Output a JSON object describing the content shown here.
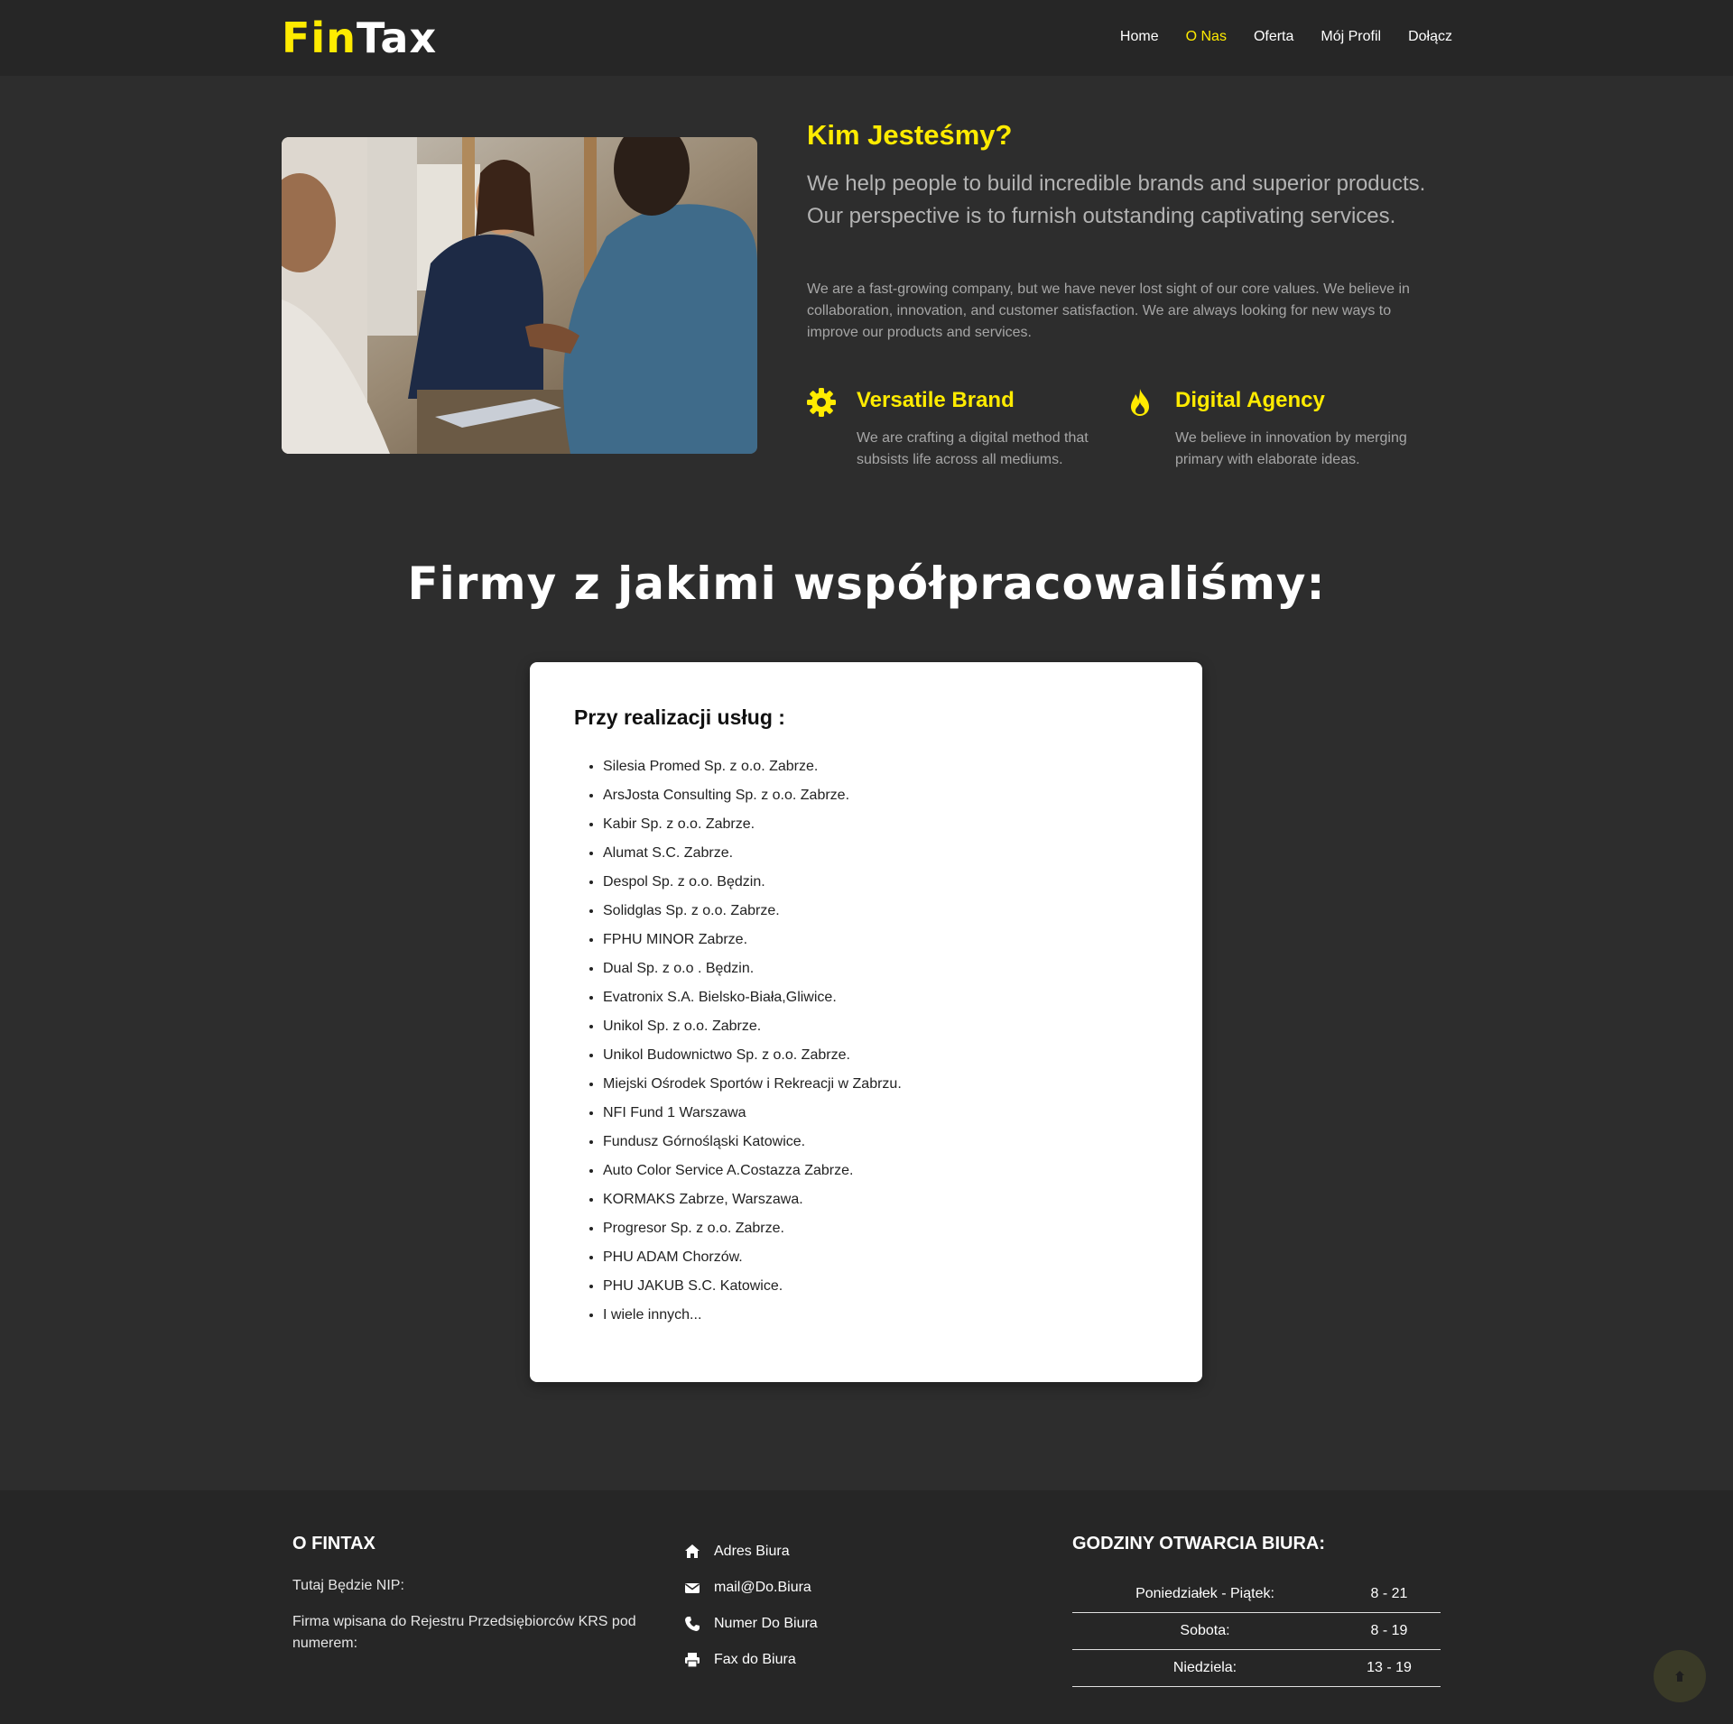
{
  "brand": {
    "part1": "Fin",
    "part2": "Tax",
    "accent": "#ffeb00"
  },
  "nav": {
    "items": [
      {
        "label": "Home"
      },
      {
        "label": "O Nas",
        "active": true
      },
      {
        "label": "Oferta"
      },
      {
        "label": "Mój Profil"
      },
      {
        "label": "Dołącz"
      }
    ]
  },
  "about": {
    "image": "business-handshake-photo",
    "title": "Kim Jesteśmy?",
    "lead": "We help people to build incredible brands and superior products. Our perspective is to furnish outstanding captivating services.",
    "text": "We are a fast-growing company, but we have never lost sight of our core values. We believe in collaboration, innovation, and customer satisfaction. We are always looking for new ways to improve our products and services.",
    "features": [
      {
        "icon": "gear-icon",
        "title": "Versatile Brand",
        "text": "We are crafting a digital method that subsists life across all mediums."
      },
      {
        "icon": "fire-icon",
        "title": "Digital Agency",
        "text": "We believe in innovation by merging primary with elaborate ideas."
      }
    ]
  },
  "partners": {
    "title": "Firmy z jakimi współpracowaliśmy:",
    "card_title": "Przy realizacji usług :",
    "items": [
      "Silesia Promed Sp. z o.o. Zabrze.",
      "ArsJosta Consulting Sp. z o.o. Zabrze.",
      "Kabir Sp. z o.o. Zabrze.",
      "Alumat S.C. Zabrze.",
      "Despol Sp. z o.o. Będzin.",
      "Solidglas Sp. z o.o. Zabrze.",
      "FPHU MINOR Zabrze.",
      "Dual Sp. z o.o . Będzin.",
      "Evatronix S.A. Bielsko-Biała,Gliwice.",
      "Unikol Sp. z o.o. Zabrze.",
      "Unikol Budownictwo Sp. z o.o. Zabrze.",
      "Miejski Ośrodek Sportów i Rekreacji w Zabrzu.",
      "NFI Fund 1 Warszawa",
      "Fundusz Górnośląski Katowice.",
      "Auto Color Service A.Costazza Zabrze.",
      "KORMAKS Zabrze, Warszawa.",
      "Progresor Sp. z o.o. Zabrze.",
      "PHU ADAM Chorzów.",
      "PHU JAKUB S.C. Katowice.",
      "I wiele innych..."
    ]
  },
  "footer": {
    "about_title": "O FINTAX",
    "nip": "Tutaj Będzie NIP:",
    "krs": "Firma wpisana do Rejestru Przedsiębiorców KRS pod numerem:",
    "contact": [
      {
        "icon": "home-icon",
        "label": "Adres Biura"
      },
      {
        "icon": "envelope-icon",
        "label": "mail@Do.Biura"
      },
      {
        "icon": "phone-icon",
        "label": "Numer Do Biura"
      },
      {
        "icon": "printer-icon",
        "label": "Fax do Biura"
      }
    ],
    "hours_title": "GODZINY OTWARCIA BIURA:",
    "hours": [
      {
        "day": "Poniedziałek - Piątek:",
        "time": "8 - 21"
      },
      {
        "day": "Sobota:",
        "time": "8 - 19"
      },
      {
        "day": "Niedziela:",
        "time": "13 - 19"
      }
    ]
  },
  "scroll_top": {
    "icon": "arrow-up-icon"
  }
}
